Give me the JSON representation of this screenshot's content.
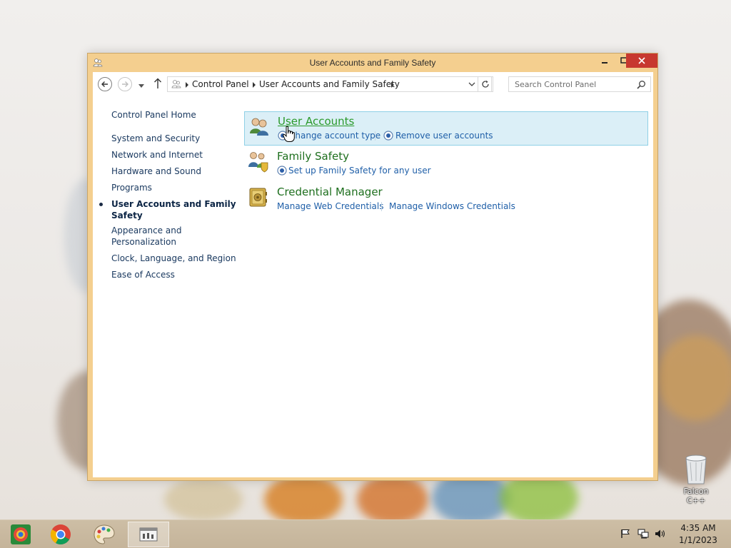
{
  "window": {
    "title": "User Accounts and Family Safety",
    "accent_color": "#f4cf8f",
    "close_color": "#c7382f"
  },
  "toolbar": {
    "back_icon": "back-arrow-icon",
    "forward_icon": "forward-arrow-icon",
    "up_icon": "up-arrow-icon",
    "breadcrumbs": [
      "Control Panel",
      "User Accounts and Family Safety"
    ],
    "search_placeholder": "Search Control Panel"
  },
  "sidebar": {
    "home": "Control Panel Home",
    "items": [
      {
        "label": "System and Security"
      },
      {
        "label": "Network and Internet"
      },
      {
        "label": "Hardware and Sound"
      },
      {
        "label": "Programs"
      },
      {
        "label_line1": "User Accounts and Family",
        "label_line2": "Safety",
        "current": true
      },
      {
        "label_line1": "Appearance and",
        "label_line2": "Personalization"
      },
      {
        "label": "Clock, Language, and Region"
      },
      {
        "label": "Ease of Access"
      }
    ]
  },
  "categories": [
    {
      "title": "User Accounts",
      "icon": "users-icon",
      "links": [
        "Change account type",
        "Remove user accounts"
      ]
    },
    {
      "title": "Family Safety",
      "icon": "family-safety-icon",
      "links": [
        "Set up Family Safety for any user"
      ]
    },
    {
      "title": "Credential Manager",
      "icon": "vault-icon",
      "links": [
        "Manage Web Credentials",
        "Manage Windows Credentials"
      ]
    }
  ],
  "desktop": {
    "recycle_bin_label": "Falcon C++"
  },
  "taskbar": {
    "time": "4:35 AM",
    "date": "1/1/2023"
  }
}
